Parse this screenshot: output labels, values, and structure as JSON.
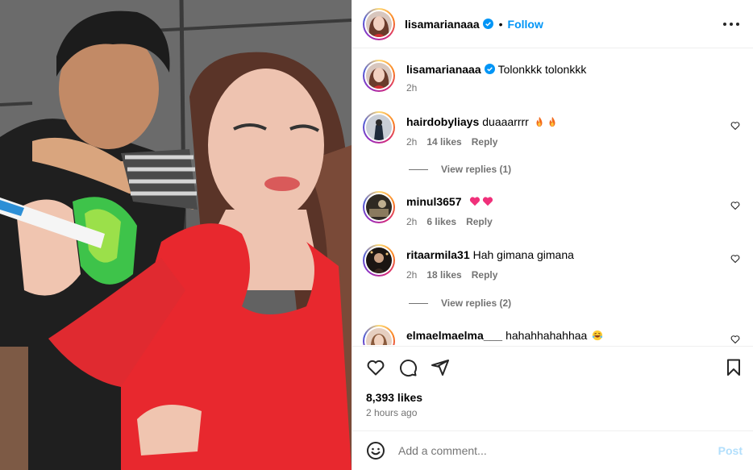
{
  "post": {
    "username": "lisamarianaaa",
    "follow_label": "Follow",
    "separator": "•",
    "caption_user": "lisamarianaaa",
    "caption_text": "Tolonkkk tolonkkk",
    "caption_time": "2h",
    "likes": "8,393 likes",
    "posted": "2 hours ago"
  },
  "comments": [
    {
      "user": "hairdobyliays",
      "text": "duaaarrrr",
      "emojis": [
        "fire",
        "fire"
      ],
      "time": "2h",
      "likes": "14 likes",
      "reply": "Reply"
    },
    {
      "user": "minul3657",
      "text": "",
      "emojis": [
        "pink-heart",
        "pink-heart"
      ],
      "time": "2h",
      "likes": "6 likes",
      "reply": "Reply"
    },
    {
      "user": "ritaarmila31",
      "text": "Hah gimana gimana",
      "emojis": [],
      "time": "2h",
      "likes": "18 likes",
      "reply": "Reply"
    },
    {
      "user": "elmaelmaelma___",
      "text": "hahahhahahhaa",
      "emojis": [
        "laughing-face"
      ],
      "time": "",
      "likes": "",
      "reply": ""
    }
  ],
  "view_replies": [
    "View replies (1)",
    "View replies (2)"
  ],
  "composer": {
    "placeholder": "Add a comment...",
    "post_label": "Post"
  },
  "colors": {
    "accent": "#0095f6",
    "post_disabled": "#b2dffc",
    "muted": "#737373",
    "dress_red": "#e8282e"
  },
  "icons": [
    "verified-badge-icon",
    "more-options-icon",
    "heart-icon",
    "comment-icon",
    "share-icon",
    "bookmark-icon",
    "emoji-icon"
  ]
}
